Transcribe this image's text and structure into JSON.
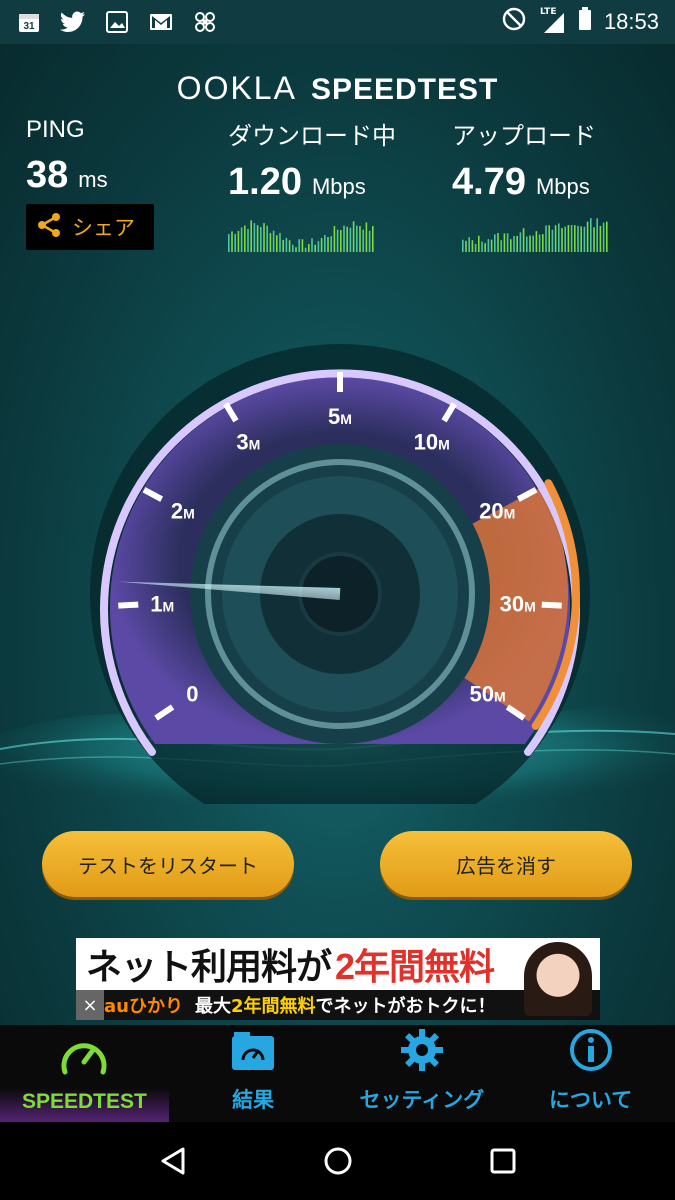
{
  "statusbar": {
    "calendar_day": "31",
    "lte": "LTE",
    "clock": "18:53"
  },
  "header": {
    "brand": "OOKLA",
    "product": "SPEEDTEST"
  },
  "stats": {
    "ping_label": "PING",
    "ping_value": "38",
    "ping_unit": "ms",
    "download_label": "ダウンロード中",
    "download_value": "1.20",
    "download_unit": "Mbps",
    "upload_label": "アップロード",
    "upload_value": "4.79",
    "upload_unit": "Mbps"
  },
  "share_label": "シェア",
  "gauge": {
    "ticks": [
      "0",
      "1",
      "2",
      "3",
      "5",
      "10",
      "20",
      "30",
      "50"
    ],
    "unit_suffix": "M",
    "needle_value_mbps": 1.2
  },
  "buttons": {
    "restart": "テストをリスタート",
    "remove_ads": "広告を消す"
  },
  "ad": {
    "headline_a": "ネット利用料が",
    "headline_b": "2年間無料",
    "brand": "auひかり",
    "sub_a": "最大",
    "sub_b": "2年間無料",
    "sub_c": "でネットがおトクに！",
    "close": "×"
  },
  "nav": {
    "speedtest": "SPEEDTEST",
    "results": "結果",
    "settings": "セッティング",
    "about": "について"
  },
  "colors": {
    "accent_orange": "#f0a81c",
    "nav_blue": "#27a7e1",
    "nav_active_green": "#7fdc35",
    "gauge_purple": "#8f6ad8"
  }
}
